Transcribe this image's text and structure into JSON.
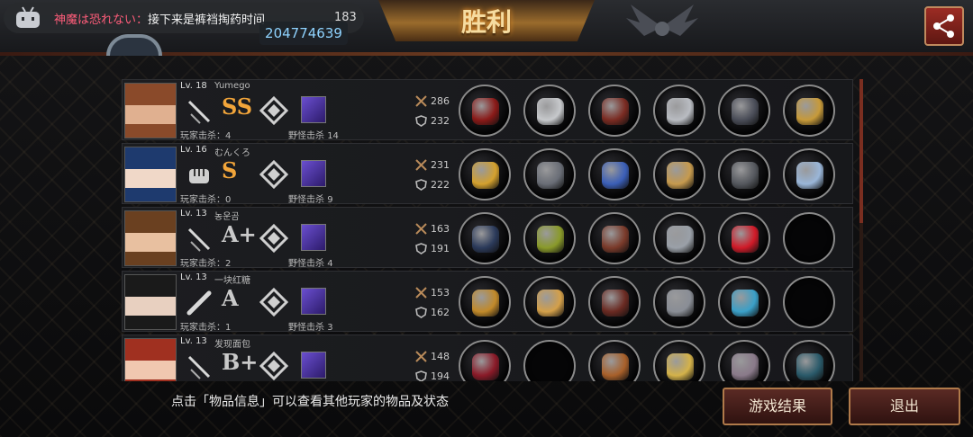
{
  "chat": {
    "sender": "神魔は恐れない：",
    "message": "接下来是裤裆掏药时间",
    "count": "183"
  },
  "room_id": "204774639",
  "banner": {
    "title": "胜利"
  },
  "footer": {
    "hint": "点击「物品信息」可以查看其他玩家的物品及状态",
    "result_label": "游戏结果",
    "exit_label": "退出"
  },
  "labels": {
    "player_kills": "玩家击杀：",
    "monster_kills": "野怪击杀"
  },
  "players": [
    {
      "level": "Lv. 18",
      "name": "Yumego",
      "rank": "SS",
      "weapon": "sword-icon",
      "player_kills": "4",
      "monster_kills": "14",
      "attack": "286",
      "defense": "232",
      "items": [
        "#8a1a18",
        "#c7c9cc",
        "#7a2b22",
        "#b9bcc2",
        "#4a4d58",
        "#c79a3a"
      ]
    },
    {
      "level": "Lv. 16",
      "name": "むんくろ",
      "rank": "S",
      "weapon": "fist-icon",
      "player_kills": "0",
      "monster_kills": "9",
      "attack": "231",
      "defense": "222",
      "items": [
        "#d4a12e",
        "#6a6e77",
        "#3b5fb8",
        "#c69a4e",
        "#55585e",
        "#9ab6d8"
      ]
    },
    {
      "level": "Lv. 13",
      "name": "농운곰",
      "rank": "A+",
      "weapon": "sword-icon",
      "player_kills": "2",
      "monster_kills": "4",
      "attack": "163",
      "defense": "191",
      "items": [
        "#2b3a5a",
        "#8a9a2a",
        "#7a3a2a",
        "#9aa0a8",
        "#d01a28",
        ""
      ]
    },
    {
      "level": "Lv. 13",
      "name": "一块红糖",
      "rank": "A",
      "weapon": "bat-icon",
      "player_kills": "1",
      "monster_kills": "3",
      "attack": "153",
      "defense": "162",
      "items": [
        "#c28a2a",
        "#d4a04a",
        "#6a2a22",
        "#8a8e96",
        "#3ba0c8",
        ""
      ]
    },
    {
      "level": "Lv. 13",
      "name": "发现面包",
      "rank": "B+",
      "weapon": "sword-icon",
      "player_kills": "",
      "monster_kills": "",
      "attack": "148",
      "defense": "194",
      "items": [
        "#8a1a28",
        "",
        "#a8602a",
        "#d4b24a",
        "#8a7a8a",
        "#2a5a6a"
      ]
    }
  ],
  "colors": {
    "rank_gold": "#f2a53a",
    "room_id": "#8fd3ff",
    "chat_name": "#ff5d7a"
  }
}
